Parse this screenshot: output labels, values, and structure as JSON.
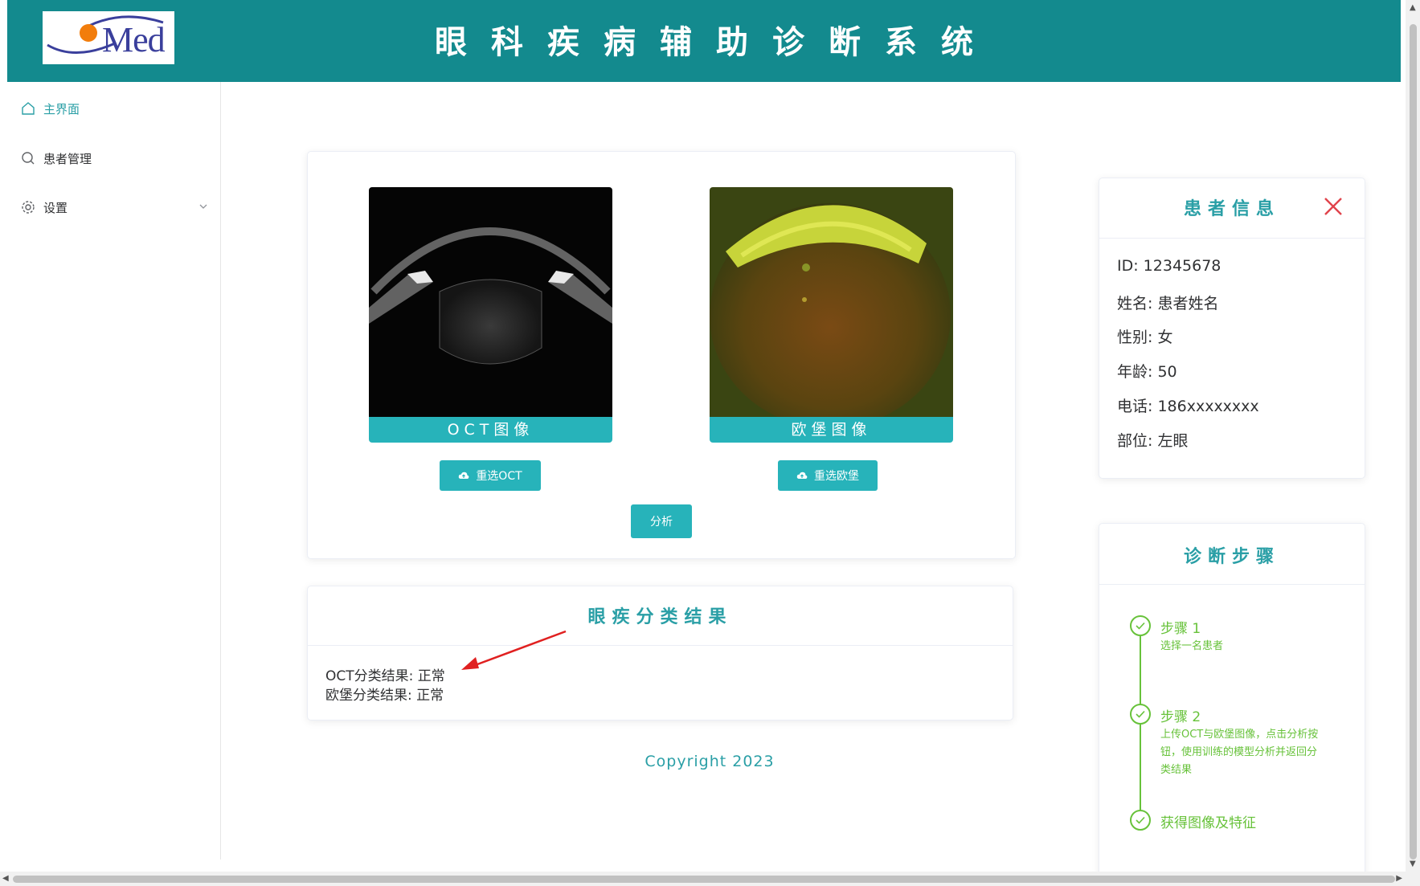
{
  "header": {
    "logo_text": "Med",
    "title": "眼科疾病辅助诊断系统"
  },
  "sidebar": {
    "items": [
      {
        "label": "主界面",
        "icon": "home-icon",
        "active": true
      },
      {
        "label": "患者管理",
        "icon": "search-icon",
        "active": false
      },
      {
        "label": "设置",
        "icon": "gear-icon",
        "active": false
      }
    ]
  },
  "images": {
    "oct_label": "OCT图像",
    "fundus_label": "欧堡图像",
    "reselect_oct": "重选OCT",
    "reselect_fundus": "重选欧堡",
    "analyze": "分析"
  },
  "results": {
    "title": "眼疾分类结果",
    "oct_result": "OCT分类结果: 正常",
    "fundus_result": "欧堡分类结果: 正常"
  },
  "footer": {
    "copyright": "Copyright 2023"
  },
  "patient": {
    "title": "患者信息",
    "id": "ID: 12345678",
    "name": "姓名: 患者姓名",
    "gender": "性别: 女",
    "age": "年龄: 50",
    "phone": "电话: 186xxxxxxxx",
    "site": "部位: 左眼"
  },
  "steps": {
    "title": "诊断步骤",
    "items": [
      {
        "title": "步骤 1",
        "desc": "选择一名患者"
      },
      {
        "title": "步骤 2",
        "desc": "上传OCT与欧堡图像，点击分析按钮，使用训练的模型分析并返回分类结果"
      },
      {
        "title": "获得图像及特征",
        "desc": ""
      }
    ]
  },
  "colors": {
    "header": "#138a8e",
    "accent": "#27b3ba",
    "step": "#67c23a",
    "close": "#e0434b"
  }
}
